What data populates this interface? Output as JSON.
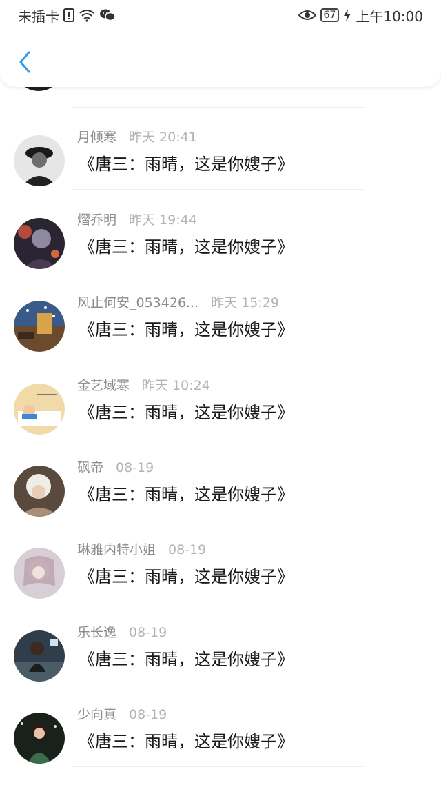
{
  "status_bar": {
    "carrier": "未插卡",
    "battery": "67",
    "time": "上午10:00",
    "icons": [
      "sim-alert-icon",
      "wifi-icon",
      "wechat-icon",
      "eye-icon",
      "battery-icon",
      "charging-icon"
    ]
  },
  "header": {
    "back_icon": "chevron-left-icon"
  },
  "items": [
    {
      "name": "月倾寒",
      "time": "昨天 20:41",
      "content": "《唐三：雨晴，这是你嫂子》",
      "avatar_color": "#2a2a2a"
    },
    {
      "name": "熠乔明",
      "time": "昨天 19:44",
      "content": "《唐三：雨晴，这是你嫂子》",
      "avatar_color": "#3a2f3f"
    },
    {
      "name": "风止何安_053426...",
      "time": "昨天 15:29",
      "content": "《唐三：雨晴，这是你嫂子》",
      "avatar_color": "#4a5a7a"
    },
    {
      "name": "金艺域寒",
      "time": "昨天 10:24",
      "content": "《唐三：雨晴，这是你嫂子》",
      "avatar_color": "#e8c89a"
    },
    {
      "name": "砜帝",
      "time": "08-19",
      "content": "《唐三：雨晴，这是你嫂子》",
      "avatar_color": "#6b5a4a"
    },
    {
      "name": "琳雅内特小姐",
      "time": "08-19",
      "content": "《唐三：雨晴，这是你嫂子》",
      "avatar_color": "#cbb7c0"
    },
    {
      "name": "乐长逸",
      "time": "08-19",
      "content": "《唐三：雨晴，这是你嫂子》",
      "avatar_color": "#3e4d57"
    },
    {
      "name": "少向真",
      "time": "08-19",
      "content": "《唐三：雨晴，这是你嫂子》",
      "avatar_color": "#1f2a22"
    }
  ]
}
